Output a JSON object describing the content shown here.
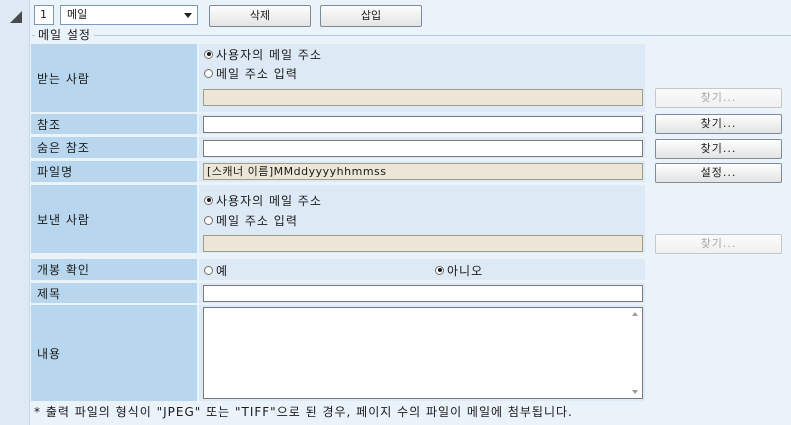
{
  "toolbar": {
    "index": "1",
    "dest_select": "메일",
    "delete_label": "삭제",
    "insert_label": "삽입"
  },
  "group_title": "메일 설정",
  "to": {
    "label": "받는 사람",
    "option_user": "사용자의 메일 주소",
    "option_enter": "메일 주소 입력",
    "value": "",
    "find_label": "찾기...",
    "selected": "user"
  },
  "cc": {
    "label": "참조",
    "value": "",
    "find_label": "찾기..."
  },
  "bcc": {
    "label": "숨은 참조",
    "value": "",
    "find_label": "찾기..."
  },
  "filename": {
    "label": "파일명",
    "value": "[스캐너 이름]MMddyyyyhhmmss",
    "settings_label": "설정..."
  },
  "from": {
    "label": "보낸 사람",
    "option_user": "사용자의 메일 주소",
    "option_enter": "메일 주소 입력",
    "value": "",
    "find_label": "찾기...",
    "selected": "user"
  },
  "read_receipt": {
    "label": "개봉 확인",
    "yes": "예",
    "no": "아니오",
    "selected": "no"
  },
  "subject": {
    "label": "제목",
    "value": ""
  },
  "body": {
    "label": "내용",
    "value": ""
  },
  "footnote": "* 출력 파일의 형식이 \"JPEG\" 또는 \"TIFF\"으로 된 경우, 페이지 수의 파일이 메일에 첨부됩니다."
}
